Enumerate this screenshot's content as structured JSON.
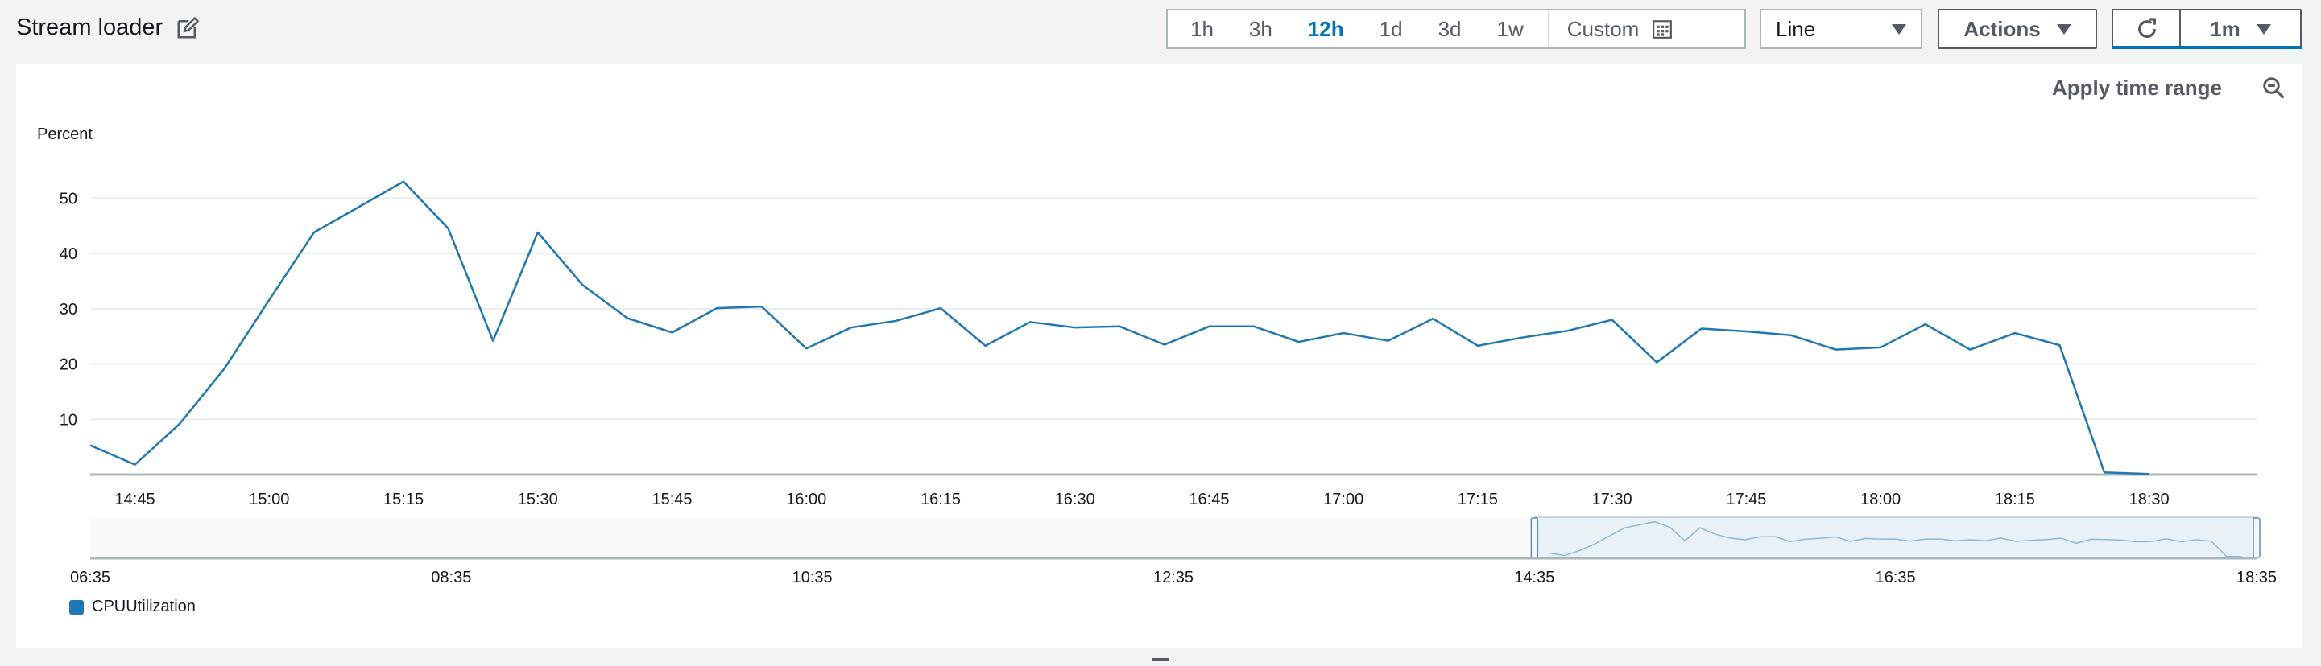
{
  "header": {
    "title": "Stream loader",
    "time_ranges": [
      "1h",
      "3h",
      "12h",
      "1d",
      "3d",
      "1w"
    ],
    "active_range": "12h",
    "custom_label": "Custom",
    "chart_type": "Line",
    "actions_label": "Actions",
    "refresh_interval": "1m"
  },
  "panel": {
    "apply_time_range": "Apply time range"
  },
  "icons": {
    "edit": "edit-icon",
    "calendar": "calendar-icon",
    "refresh": "refresh-icon",
    "zoom_out": "zoom-out-icon"
  },
  "colors": {
    "series": "#1f77b4",
    "active": "#0073bb",
    "navigator_fill": "#e8f1f8"
  },
  "chart_data": {
    "type": "line",
    "ylabel": "Percent",
    "ylim": [
      0,
      55
    ],
    "y_ticks": [
      10,
      20,
      30,
      40,
      50
    ],
    "x_ticks": [
      "14:45",
      "15:00",
      "15:15",
      "15:30",
      "15:45",
      "16:00",
      "16:15",
      "16:30",
      "16:45",
      "17:00",
      "17:15",
      "17:30",
      "17:45",
      "18:00",
      "18:15",
      "18:30"
    ],
    "grid": true,
    "legend_position": "bottom-left",
    "series": [
      {
        "name": "CPUUtilization",
        "x": [
          "14:40",
          "14:45",
          "14:50",
          "14:55",
          "15:00",
          "15:05",
          "15:10",
          "15:15",
          "15:20",
          "15:25",
          "15:30",
          "15:35",
          "15:40",
          "15:45",
          "15:50",
          "15:55",
          "16:00",
          "16:05",
          "16:10",
          "16:15",
          "16:20",
          "16:25",
          "16:30",
          "16:35",
          "16:40",
          "16:45",
          "16:50",
          "16:55",
          "17:00",
          "17:05",
          "17:10",
          "17:15",
          "17:20",
          "17:25",
          "17:30",
          "17:35",
          "17:40",
          "17:45",
          "17:50",
          "17:55",
          "18:00",
          "18:05",
          "18:10",
          "18:15",
          "18:20",
          "18:25",
          "18:30"
        ],
        "values": [
          5.3,
          1.8,
          9.2,
          19.2,
          31.6,
          43.8,
          48.4,
          53.0,
          44.5,
          24.2,
          43.8,
          34.3,
          28.3,
          25.7,
          30.1,
          30.4,
          22.8,
          26.6,
          27.8,
          30.1,
          23.3,
          27.6,
          26.6,
          26.8,
          23.5,
          26.8,
          26.8,
          24.0,
          25.6,
          24.2,
          28.2,
          23.3,
          24.8,
          26.0,
          28.0,
          20.3,
          26.4,
          25.9,
          25.2,
          22.6,
          23.0,
          27.2,
          22.6,
          25.6,
          23.4,
          0.4,
          0.1
        ]
      }
    ],
    "navigator": {
      "x_ticks": [
        "06:35",
        "08:35",
        "10:35",
        "12:35",
        "14:35",
        "16:35",
        "18:35"
      ],
      "selected_range": [
        "14:35",
        "18:35"
      ]
    }
  }
}
